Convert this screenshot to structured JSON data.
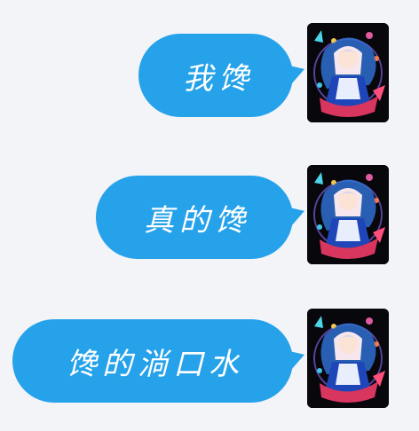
{
  "messages": [
    {
      "text": "我馋"
    },
    {
      "text": "真的馋"
    },
    {
      "text": "馋的淌口水"
    }
  ],
  "colors": {
    "background": "#f3f4f8",
    "bubble": "#26a2ea",
    "bubble_text": "#ffffff"
  },
  "icons": {
    "avatar": "anime-character-avatar"
  }
}
